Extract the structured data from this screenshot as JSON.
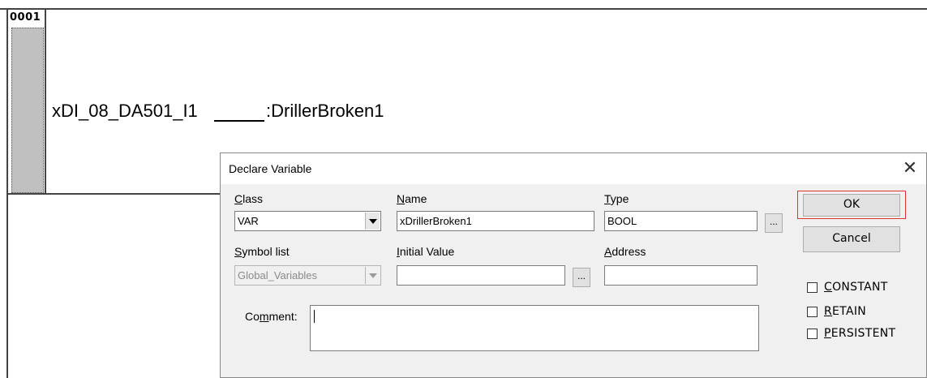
{
  "editor": {
    "rung_number": "0001",
    "input_contact": "xDI_08_DA501_I1",
    "output_coil": ":DrillerBroken1"
  },
  "dialog": {
    "title": "Declare Variable",
    "close_glyph": "✕",
    "class": {
      "label_ul": "C",
      "label_rest": "lass",
      "value": "VAR"
    },
    "name": {
      "label_ul": "N",
      "label_rest": "ame",
      "value": "xDrillerBroken1"
    },
    "type": {
      "label_ul": "T",
      "label_rest": "ype",
      "value": "BOOL",
      "browse": "..."
    },
    "symbol_list": {
      "label_ul": "S",
      "label_rest": "ymbol list",
      "value": "Global_Variables"
    },
    "initial_value": {
      "label_ul": "I",
      "label_rest": "nitial Value",
      "value": "",
      "browse": "..."
    },
    "address": {
      "label_ul": "A",
      "label_rest": "ddress",
      "value": ""
    },
    "comment": {
      "label_pre": "Co",
      "label_ul": "m",
      "label_rest": "ment:",
      "value": ""
    },
    "ok_label": "OK",
    "cancel_label": "Cancel",
    "checkboxes": [
      {
        "ul": "C",
        "rest": "ONSTANT",
        "checked": false
      },
      {
        "ul": "R",
        "rest": "ETAIN",
        "checked": false
      },
      {
        "ul": "P",
        "rest": "ERSISTENT",
        "checked": false
      }
    ],
    "highlight_color": "#e03030"
  }
}
